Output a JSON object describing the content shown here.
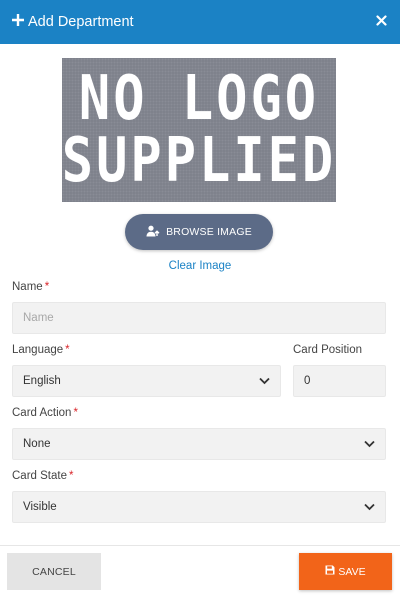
{
  "dialog": {
    "title": "Add Department",
    "title_icon": "plus-icon",
    "close_icon": "close-icon",
    "header_color": "#1b82c5"
  },
  "logo": {
    "line1": "NO LOGO",
    "line2": "SUPPLIED"
  },
  "browse": {
    "label": "BROWSE IMAGE",
    "icon": "user-upload-icon",
    "color": "#5c6b87"
  },
  "clear": {
    "label": "Clear Image"
  },
  "form": {
    "name": {
      "label": "Name",
      "required_mark": "*",
      "placeholder": "Name",
      "value": ""
    },
    "language": {
      "label": "Language",
      "required_mark": "*",
      "value": "English"
    },
    "card_position": {
      "label": "Card Position",
      "value": "0"
    },
    "card_action": {
      "label": "Card Action",
      "required_mark": "*",
      "value": "None"
    },
    "card_state": {
      "label": "Card State",
      "required_mark": "*",
      "value": "Visible"
    }
  },
  "footer": {
    "cancel_label": "CANCEL",
    "save_label": "SAVE",
    "save_icon": "save-icon",
    "save_color": "#f26419"
  }
}
